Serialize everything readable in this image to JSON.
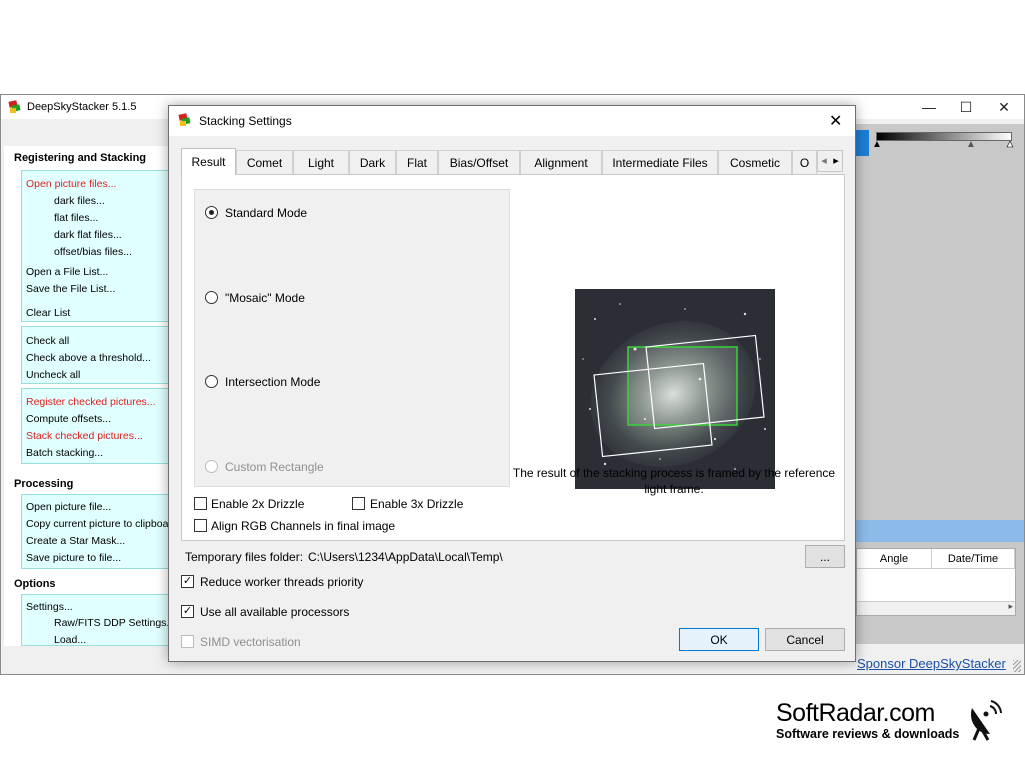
{
  "main_window": {
    "title": "DeepSkyStacker 5.1.5",
    "controls": {
      "minimize": "—",
      "maximize": "☐",
      "close": "✕"
    }
  },
  "left_panel": {
    "registering": {
      "title": "Registering and Stacking",
      "group1": [
        "Open picture files...",
        "dark files...",
        "flat files...",
        "dark flat files...",
        "offset/bias files...",
        "Open a File List...",
        "Save the File List...",
        "Clear List"
      ],
      "group2": [
        "Check all",
        "Check above a threshold...",
        "Uncheck all"
      ],
      "group3": [
        "Register checked pictures...",
        "Compute offsets...",
        "Stack checked pictures...",
        "Batch stacking..."
      ]
    },
    "processing": {
      "title": "Processing",
      "items": [
        "Open picture file...",
        "Copy current picture to clipboard",
        "Create a Star Mask...",
        "Save picture to file..."
      ]
    },
    "options": {
      "title": "Options",
      "items": [
        "Settings...",
        "Raw/FITS DDP Settings...",
        "Load..."
      ]
    }
  },
  "right_pane": {
    "grid_headers": [
      "Angle",
      "Date/Time"
    ],
    "sponsor": "Sponsor DeepSkyStacker"
  },
  "dialog": {
    "title": "Stacking Settings",
    "close": "✕",
    "tabs": [
      "Result",
      "Comet",
      "Light",
      "Dark",
      "Flat",
      "Bias/Offset",
      "Alignment",
      "Intermediate Files",
      "Cosmetic",
      "O"
    ],
    "active_tab": "Result",
    "tab_scroll": {
      "left": "◂",
      "right": "▸"
    },
    "modes": [
      {
        "label": "Standard Mode",
        "checked": true,
        "disabled": false
      },
      {
        "label": "\"Mosaic\" Mode",
        "checked": false,
        "disabled": false
      },
      {
        "label": "Intersection Mode",
        "checked": false,
        "disabled": false
      },
      {
        "label": "Custom Rectangle",
        "checked": false,
        "disabled": true
      }
    ],
    "drizzle2x": "Enable 2x Drizzle",
    "drizzle3x": "Enable 3x Drizzle",
    "align_rgb": "Align RGB Channels in final image",
    "description": "The result of the stacking process is framed by the reference light frame.",
    "temp_label": "Temporary files folder:",
    "temp_path": "C:\\Users\\1234\\AppData\\Local\\Temp\\",
    "browse": "...",
    "reduce_threads": {
      "label": "Reduce worker threads priority",
      "checked": true
    },
    "use_all": {
      "label": "Use all available processors",
      "checked": true
    },
    "simd": {
      "label": "SIMD vectorisation",
      "checked": false,
      "disabled": true
    },
    "ok": "OK",
    "cancel": "Cancel"
  },
  "watermark": {
    "brand": "SoftRadar.com",
    "tagline": "Software reviews & downloads"
  }
}
